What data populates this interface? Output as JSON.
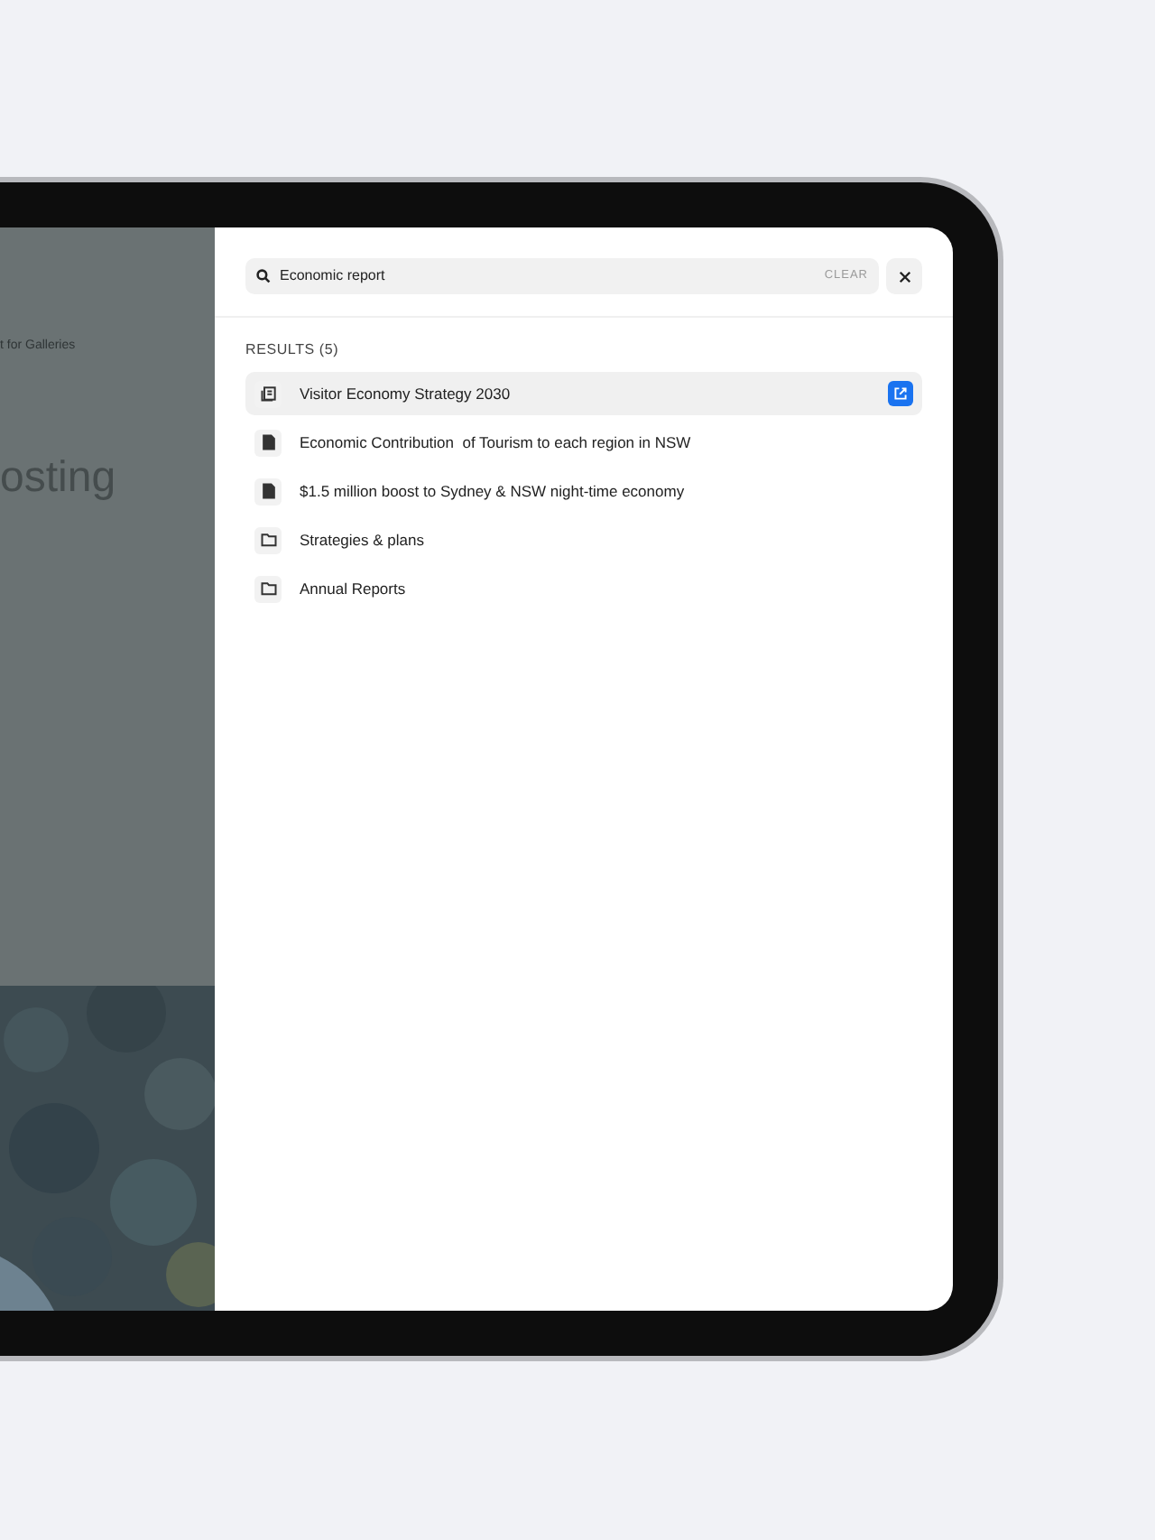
{
  "backdrop": {
    "breadcrumb": "t for Galleries",
    "heading": "osting"
  },
  "search": {
    "value": "Economic report",
    "clear": "CLEAR"
  },
  "results_label": "RESULTS (5)",
  "results": [
    {
      "title": "Visitor Economy Strategy 2030",
      "kind": "pages",
      "selected": true
    },
    {
      "title": "Economic Contribution  of Tourism to each region in NSW",
      "kind": "document",
      "selected": false
    },
    {
      "title": "$1.5 million boost to Sydney & NSW night-time economy",
      "kind": "document",
      "selected": false
    },
    {
      "title": "Strategies & plans",
      "kind": "folder",
      "selected": false
    },
    {
      "title": "Annual Reports",
      "kind": "folder",
      "selected": false
    }
  ]
}
